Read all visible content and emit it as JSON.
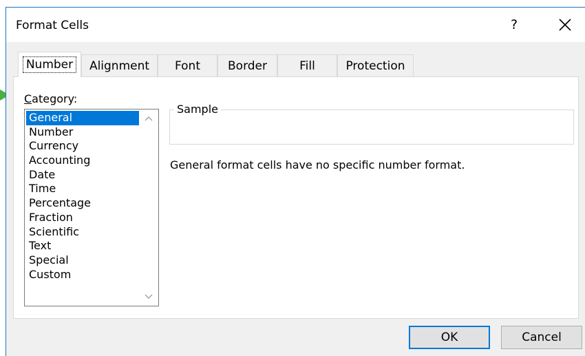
{
  "window": {
    "title": "Format Cells",
    "help_label": "?",
    "accent_color": "#0078d7",
    "indicator_color": "#4caf3e"
  },
  "tabs": [
    {
      "label": "Number",
      "active": true
    },
    {
      "label": "Alignment",
      "active": false
    },
    {
      "label": "Font",
      "active": false
    },
    {
      "label": "Border",
      "active": false
    },
    {
      "label": "Fill",
      "active": false
    },
    {
      "label": "Protection",
      "active": false
    }
  ],
  "category": {
    "label_first": "C",
    "label_rest": "ategory:",
    "items": [
      "General",
      "Number",
      "Currency",
      "Accounting",
      "Date",
      "Time",
      "Percentage",
      "Fraction",
      "Scientific",
      "Text",
      "Special",
      "Custom"
    ],
    "selected": "General"
  },
  "sample": {
    "legend": "Sample",
    "value": ""
  },
  "description": "General format cells have no specific number format.",
  "buttons": {
    "ok": "OK",
    "cancel": "Cancel"
  },
  "icons": {
    "close": "close-icon",
    "help": "help-icon",
    "scroll_up": "chevron-up-icon",
    "scroll_down": "chevron-down-icon"
  }
}
